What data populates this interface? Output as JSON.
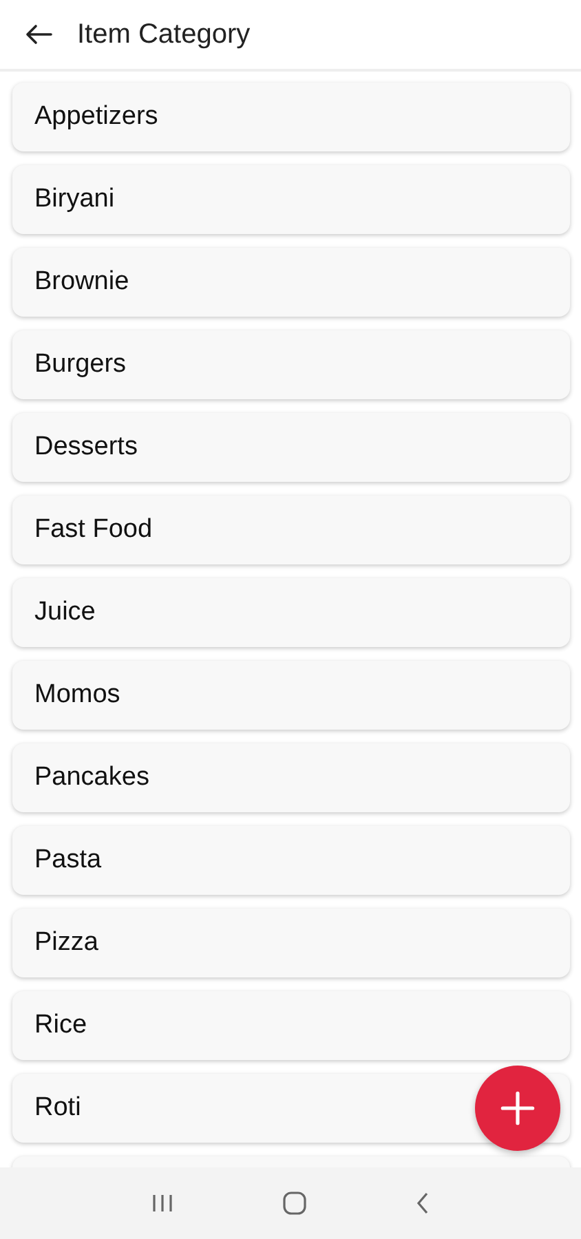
{
  "app_bar": {
    "title": "Item Category"
  },
  "categories": [
    {
      "name": "Appetizers"
    },
    {
      "name": "Biryani"
    },
    {
      "name": "Brownie"
    },
    {
      "name": "Burgers"
    },
    {
      "name": "Desserts"
    },
    {
      "name": "Fast Food"
    },
    {
      "name": "Juice"
    },
    {
      "name": "Momos"
    },
    {
      "name": "Pancakes"
    },
    {
      "name": "Pasta"
    },
    {
      "name": "Pizza"
    },
    {
      "name": "Rice"
    },
    {
      "name": "Roti"
    }
  ]
}
